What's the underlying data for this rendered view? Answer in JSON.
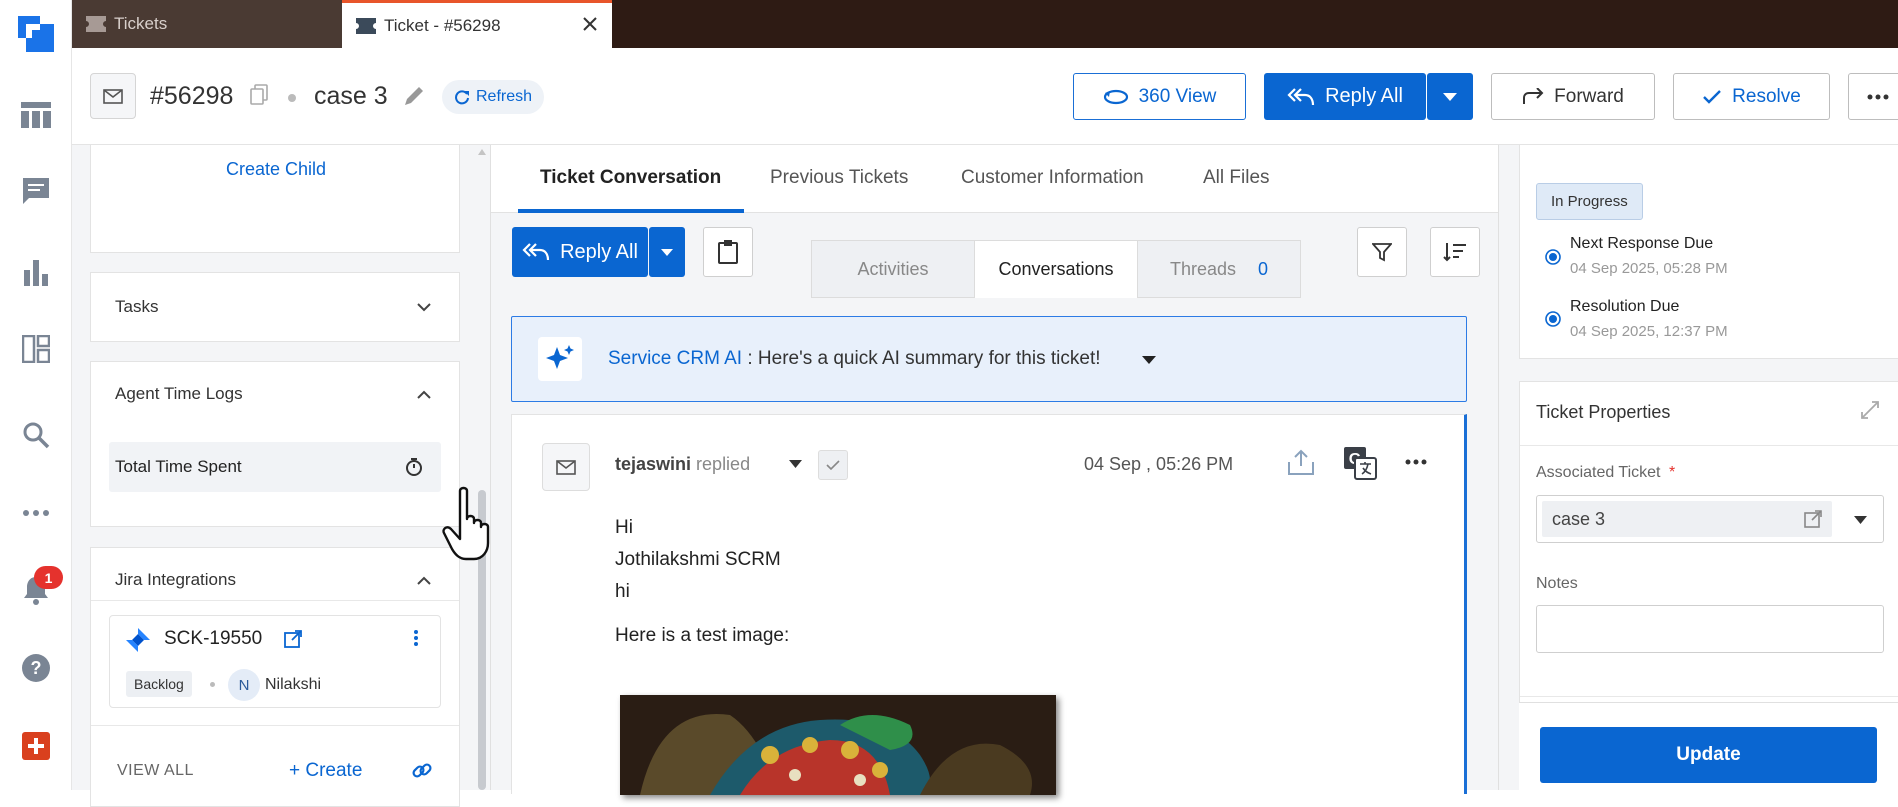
{
  "window_tabs": [
    {
      "label": "Tickets"
    },
    {
      "label": "Ticket - #56298"
    }
  ],
  "rail": {
    "notification_count": "1"
  },
  "header": {
    "ticket_id": "#56298",
    "ticket_name": "case 3",
    "refresh_label": "Refresh",
    "view360_label": "360 View",
    "reply_all_label": "Reply All",
    "forward_label": "Forward",
    "resolve_label": "Resolve"
  },
  "left": {
    "create_child_label": "Create Child",
    "tasks_title": "Tasks",
    "time_logs_title": "Agent Time Logs",
    "total_time_label": "Total Time Spent",
    "jira_title": "Jira Integrations",
    "jira_issue_key": "SCK-19550",
    "jira_status": "Backlog",
    "jira_assignee_initial": "N",
    "jira_assignee": "Nilakshi",
    "view_all_label": "VIEW ALL",
    "create_label": "+ Create"
  },
  "middle": {
    "tabs": [
      {
        "label": "Ticket Conversation"
      },
      {
        "label": "Previous Tickets"
      },
      {
        "label": "Customer Information"
      },
      {
        "label": "All Files"
      }
    ],
    "reply_all_label": "Reply All",
    "segments": {
      "activities": "Activities",
      "conversations": "Conversations",
      "threads": "Threads",
      "threads_count": "0"
    },
    "ai_banner": {
      "brand": "Service CRM AI",
      "text": " : Here's a quick AI summary for this ticket!"
    },
    "message": {
      "author": "tejaswini",
      "action": "replied",
      "timestamp": "04 Sep , 05:26 PM",
      "lines": [
        "Hi",
        "Jothilakshmi SCRM",
        "hi"
      ],
      "image_caption": "Here is a test image:"
    }
  },
  "right": {
    "status_badge": "In Progress",
    "next_response_label": "Next Response Due",
    "next_response_time": "04 Sep 2025, 05:28 PM",
    "resolution_label": "Resolution Due",
    "resolution_time": "04 Sep 2025, 12:37 PM",
    "properties_title": "Ticket Properties",
    "associated_label": "Associated Ticket",
    "required_mark": "*",
    "associated_value": "case 3",
    "notes_label": "Notes",
    "notes_value": "",
    "update_label": "Update"
  },
  "colors": {
    "accent_blue": "#0a66d1",
    "tab_active_border": "#e8552a",
    "notification_red": "#e5322d",
    "titlebar": "#2e1b14"
  }
}
